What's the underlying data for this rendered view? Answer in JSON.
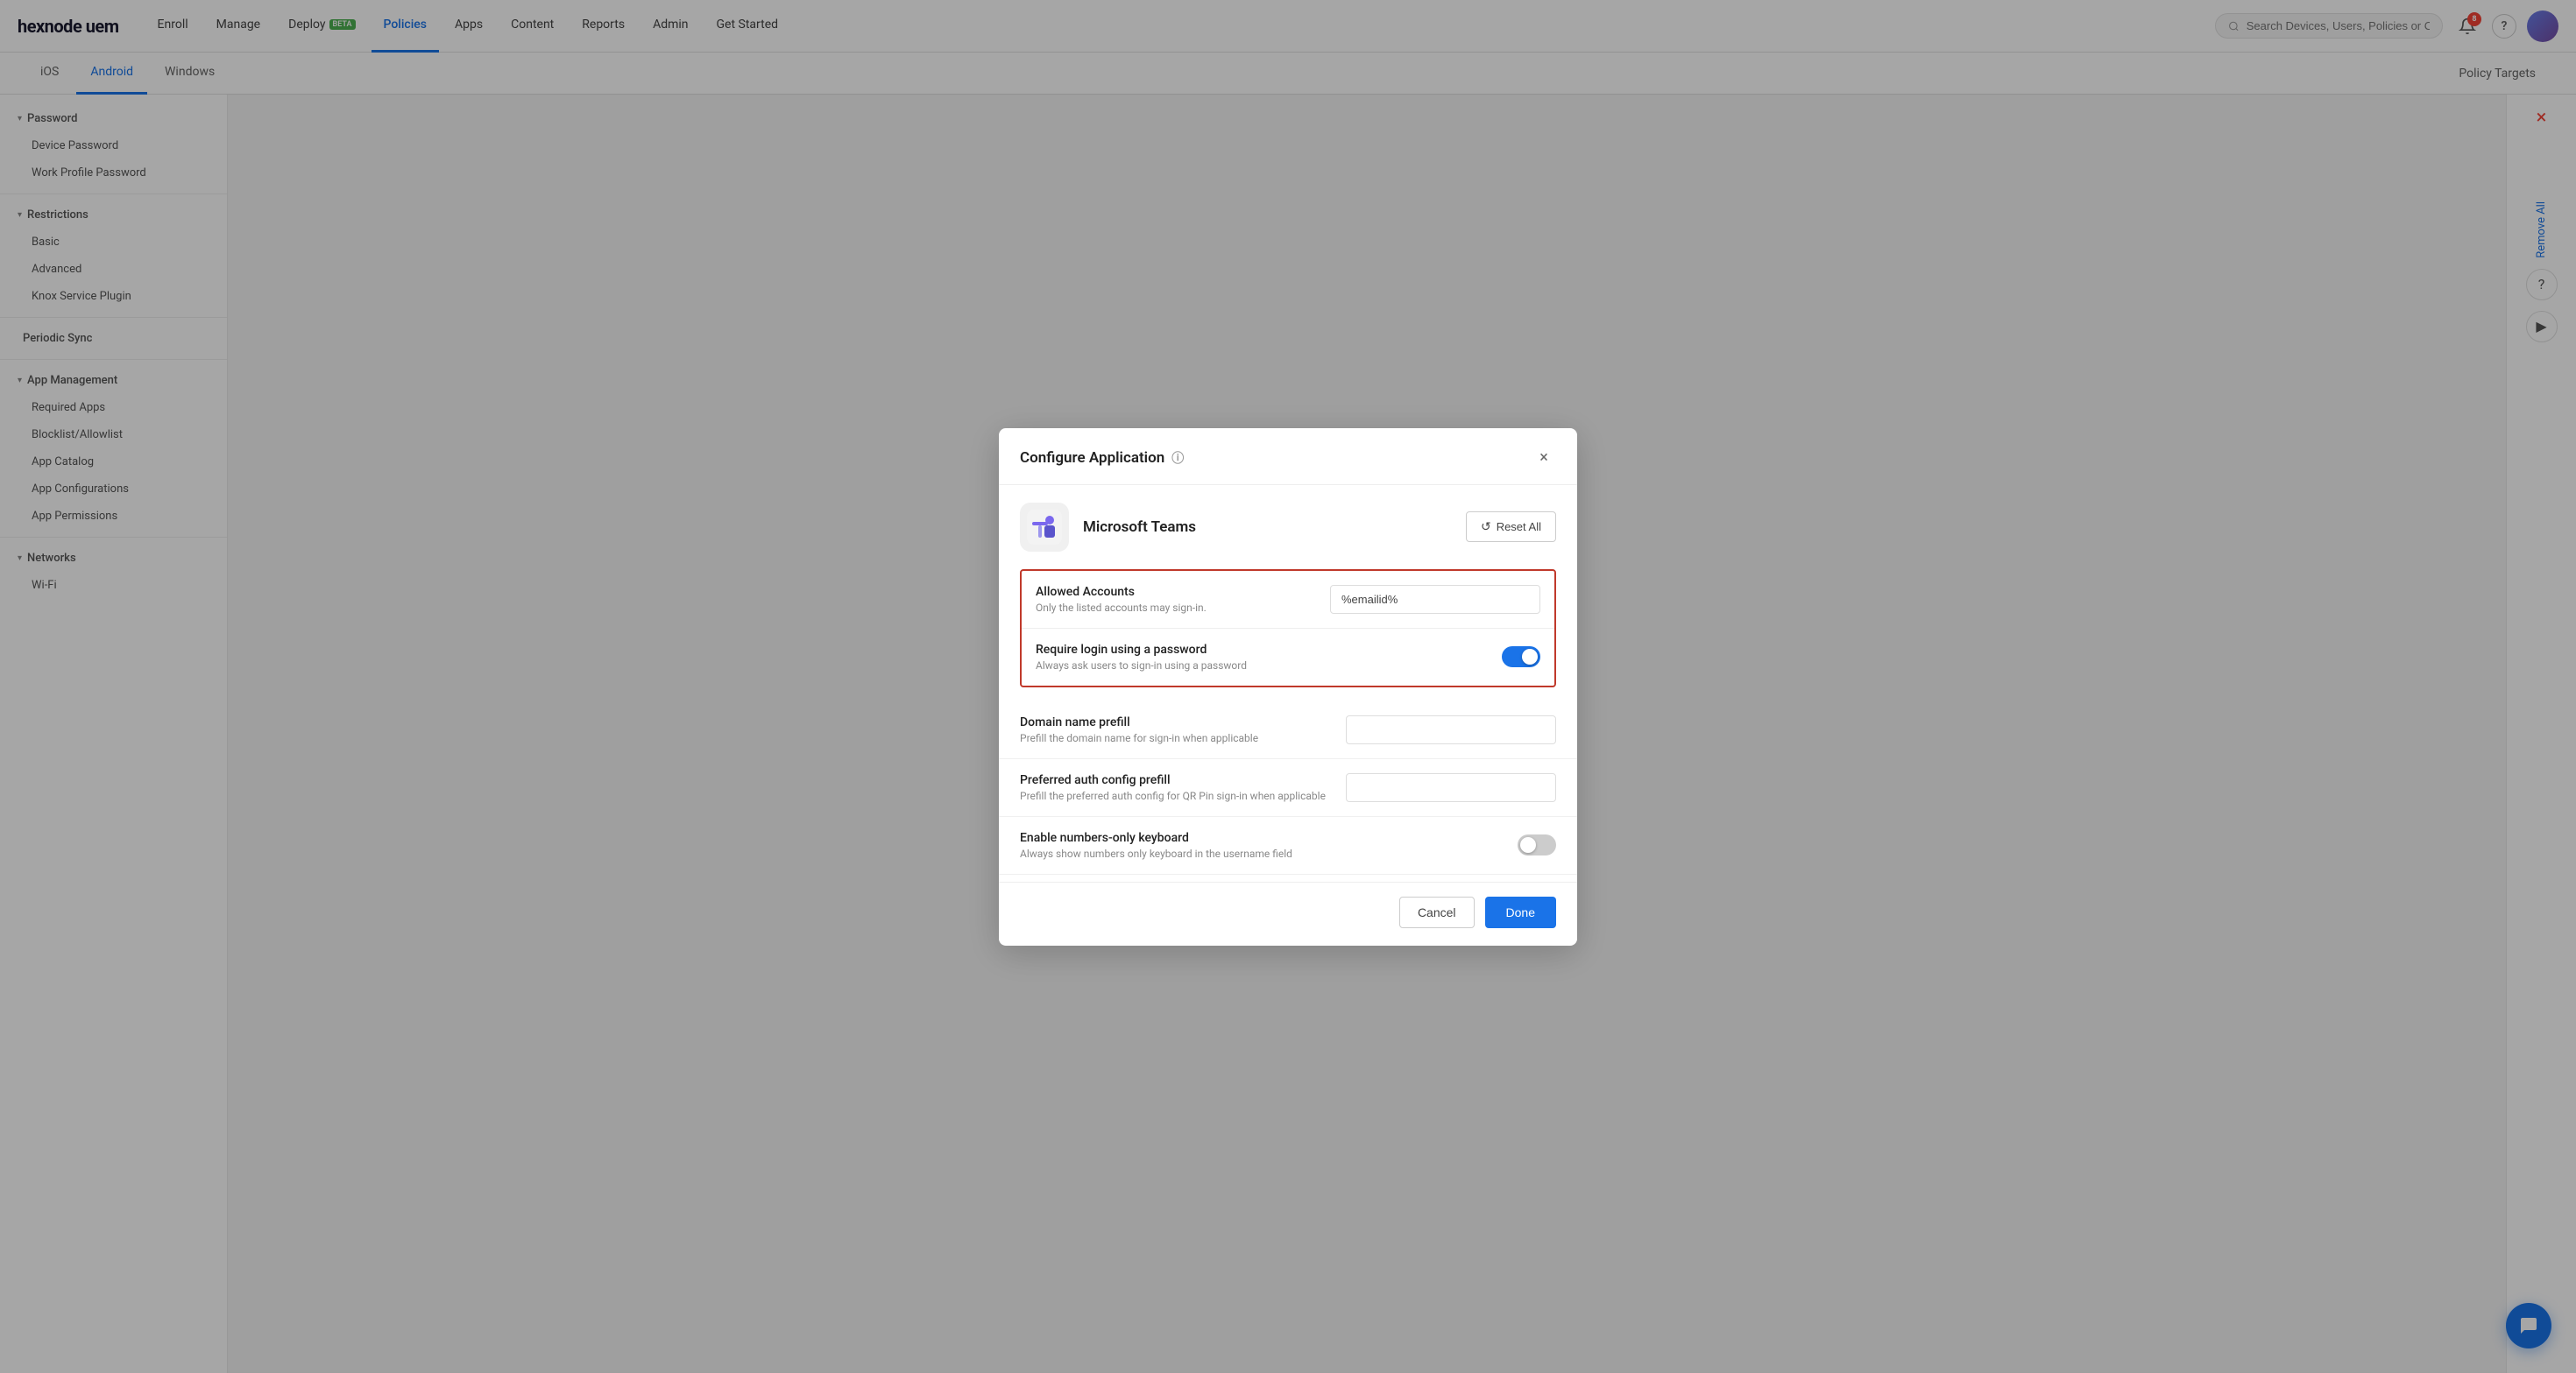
{
  "logo": {
    "text": "hexnode uem"
  },
  "nav": {
    "items": [
      {
        "id": "enroll",
        "label": "Enroll",
        "active": false
      },
      {
        "id": "manage",
        "label": "Manage",
        "active": false
      },
      {
        "id": "deploy",
        "label": "Deploy",
        "badge": "BETA",
        "active": false
      },
      {
        "id": "policies",
        "label": "Policies",
        "active": true
      },
      {
        "id": "apps",
        "label": "Apps",
        "active": false
      },
      {
        "id": "content",
        "label": "Content",
        "active": false
      },
      {
        "id": "reports",
        "label": "Reports",
        "active": false
      },
      {
        "id": "admin",
        "label": "Admin",
        "active": false
      },
      {
        "id": "get-started",
        "label": "Get Started",
        "active": false
      }
    ],
    "search_placeholder": "Search Devices, Users, Policies or Content",
    "notification_count": "8"
  },
  "sub_tabs": {
    "items": [
      {
        "id": "ios",
        "label": "iOS",
        "active": false
      },
      {
        "id": "android",
        "label": "Android",
        "active": true
      },
      {
        "id": "windows",
        "label": "Windows",
        "active": false
      }
    ],
    "right_items": [
      {
        "id": "policy-targets",
        "label": "Policy Targets"
      }
    ]
  },
  "sidebar": {
    "groups": [
      {
        "id": "password",
        "label": "Password",
        "expanded": true,
        "items": [
          {
            "id": "device-password",
            "label": "Device Password"
          },
          {
            "id": "work-profile-password",
            "label": "Work Profile Password"
          }
        ]
      },
      {
        "id": "restrictions",
        "label": "Restrictions",
        "expanded": true,
        "items": [
          {
            "id": "basic",
            "label": "Basic"
          },
          {
            "id": "advanced",
            "label": "Advanced"
          },
          {
            "id": "knox-service-plugin",
            "label": "Knox Service Plugin"
          }
        ]
      },
      {
        "id": "periodic-sync",
        "label": "Periodic Sync",
        "expanded": false,
        "items": []
      },
      {
        "id": "app-management",
        "label": "App Management",
        "expanded": true,
        "items": [
          {
            "id": "required-apps",
            "label": "Required Apps"
          },
          {
            "id": "blocklist-allowlist",
            "label": "Blocklist/Allowlist"
          },
          {
            "id": "app-catalog",
            "label": "App Catalog"
          },
          {
            "id": "app-configurations",
            "label": "App Configurations"
          },
          {
            "id": "app-permissions",
            "label": "App Permissions"
          }
        ]
      },
      {
        "id": "networks",
        "label": "Networks",
        "expanded": true,
        "items": [
          {
            "id": "wi-fi",
            "label": "Wi-Fi"
          }
        ]
      }
    ]
  },
  "modal": {
    "title": "Configure Application",
    "app_name": "Microsoft Teams",
    "reset_button": "Reset All",
    "close_label": "×",
    "fields": [
      {
        "id": "allowed-accounts",
        "label": "Allowed Accounts",
        "description": "Only the listed accounts may sign-in.",
        "type": "text",
        "value": "%emailid%",
        "highlighted": true
      },
      {
        "id": "require-login",
        "label": "Require login using a password",
        "description": "Always ask users to sign-in using a password",
        "type": "toggle",
        "value": true,
        "highlighted": true
      },
      {
        "id": "domain-name-prefill",
        "label": "Domain name prefill",
        "description": "Prefill the domain name for sign-in when applicable",
        "type": "text",
        "value": ""
      },
      {
        "id": "preferred-auth-config",
        "label": "Preferred auth config prefill",
        "description": "Prefill the preferred auth config for QR Pin sign-in when applicable",
        "type": "text",
        "value": ""
      },
      {
        "id": "numbers-only-keyboard",
        "label": "Enable numbers-only keyboard",
        "description": "Always show numbers only keyboard in the username field",
        "type": "toggle",
        "value": false
      }
    ],
    "cancel_label": "Cancel",
    "done_label": "Done"
  },
  "right_panel": {
    "remove_all": "Remove All",
    "help_icon": "?",
    "play_icon": "▶"
  },
  "chat_fab": {
    "label": "Chat"
  }
}
